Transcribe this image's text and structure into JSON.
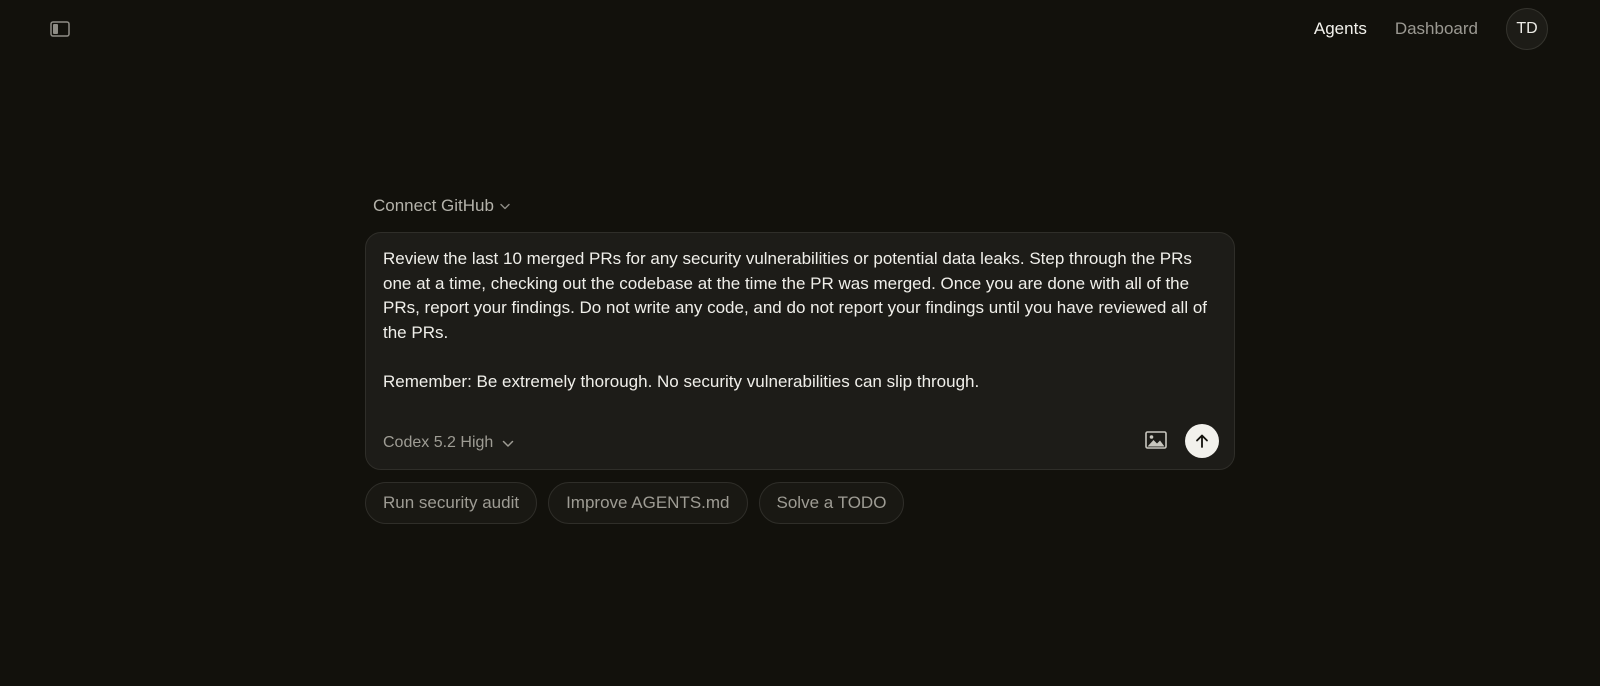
{
  "topbar": {
    "sidebar_toggle_icon": "sidebar-toggle-icon",
    "nav": [
      {
        "label": "Agents",
        "active": true
      },
      {
        "label": "Dashboard",
        "active": false
      }
    ],
    "avatar_initials": "TD"
  },
  "composer": {
    "repo_selector_label": "Connect GitHub",
    "prompt": "Review the last 10 merged PRs for any security vulnerabilities or potential data leaks. Step through the PRs one at a time, checking out the codebase at the time the PR was merged. Once you are done with all of the PRs, report your findings. Do not write any code, and do not report your findings until you have reviewed all of the PRs.\n\nRemember: Be extremely thorough. No security vulnerabilities can slip through.",
    "model_selector_label": "Codex 5.2 High",
    "attach_image_icon": "image-icon",
    "send_icon": "arrow-up-icon"
  },
  "suggestions": [
    {
      "label": "Run security audit"
    },
    {
      "label": "Improve AGENTS.md"
    },
    {
      "label": "Solve a TODO"
    }
  ],
  "colors": {
    "background": "#12110c",
    "surface": "#1d1c18",
    "border": "#2f2e29",
    "text_primary": "#f0efea",
    "text_muted": "#9e9c94",
    "send_button": "#f2f1ec"
  }
}
